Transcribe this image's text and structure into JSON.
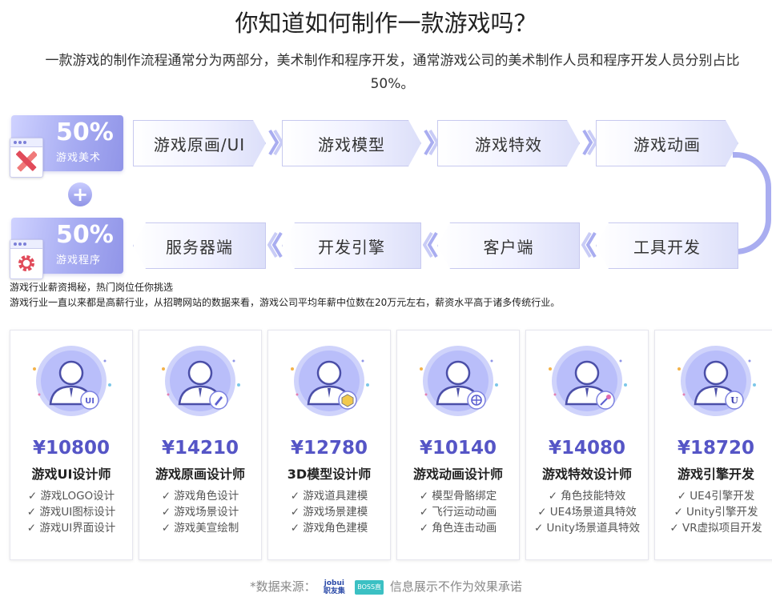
{
  "header": {
    "title": "你知道如何制作一款游戏吗？",
    "subtitle": "一款游戏的制作流程通常分为两部分，美术制作和程序开发，通常游戏公司的美术制作人员和程序开发人员分别占比50%。"
  },
  "badges": {
    "art": {
      "percent": "50%",
      "label": "游戏美术",
      "icon": "pencil-ruler-icon"
    },
    "program": {
      "percent": "50%",
      "label": "游戏程序",
      "icon": "gear-icon"
    },
    "plus": "+"
  },
  "flow": {
    "top": [
      "游戏原画/UI",
      "游戏模型",
      "游戏特效",
      "游戏动画"
    ],
    "bottom": [
      "服务器端",
      "开发引擎",
      "客户端",
      "工具开发"
    ]
  },
  "info": {
    "line1": "游戏行业薪资揭秘，热门岗位任你挑选",
    "line2": "游戏行业一直以来都是高薪行业，从招聘网站的数据来看，游戏公司平均年薪中位数在20万元左右，薪资水平高于诸多传统行业。"
  },
  "cards": [
    {
      "salary": "¥10800",
      "role": "游戏UI设计师",
      "badge": "UI",
      "items": [
        "✓ 游戏LOGO设计",
        "✓ 游戏UI图标设计",
        "✓ 游戏UI界面设计"
      ]
    },
    {
      "salary": "¥14210",
      "role": "游戏原画设计师",
      "badge": "pen",
      "items": [
        "✓ 游戏角色设计",
        "✓ 游戏场景设计",
        "✓ 游戏美宣绘制"
      ]
    },
    {
      "salary": "¥12780",
      "role": "3D模型设计师",
      "badge": "cube",
      "items": [
        "✓ 游戏道具建模",
        "✓ 游戏场景建模",
        "✓ 游戏角色建模"
      ]
    },
    {
      "salary": "¥10140",
      "role": "游戏动画设计师",
      "badge": "skeleton",
      "items": [
        "✓ 模型骨骼绑定",
        "✓ 飞行运动动画",
        "✓ 角色连击动画"
      ]
    },
    {
      "salary": "¥14080",
      "role": "游戏特效设计师",
      "badge": "wand",
      "items": [
        "✓ 角色技能特效",
        "✓ UE4场景道具特效",
        "✓ Unity场景道具特效"
      ]
    },
    {
      "salary": "¥18720",
      "role": "游戏引擎开发",
      "badge": "U",
      "items": [
        "✓ UE4引擎开发",
        "✓ Unity引擎开发",
        "✓ VR虚拟项目开发"
      ]
    }
  ],
  "footer": {
    "label": "*数据来源：",
    "logo1": "jobui",
    "logo1_sub": "职友集",
    "logo2": "BOSS直聘",
    "note": "信息展示不作为效果承诺"
  },
  "colors": {
    "accent": "#5555c6",
    "badge": "#a7acf2",
    "flow_border": "#c7c9ef"
  }
}
